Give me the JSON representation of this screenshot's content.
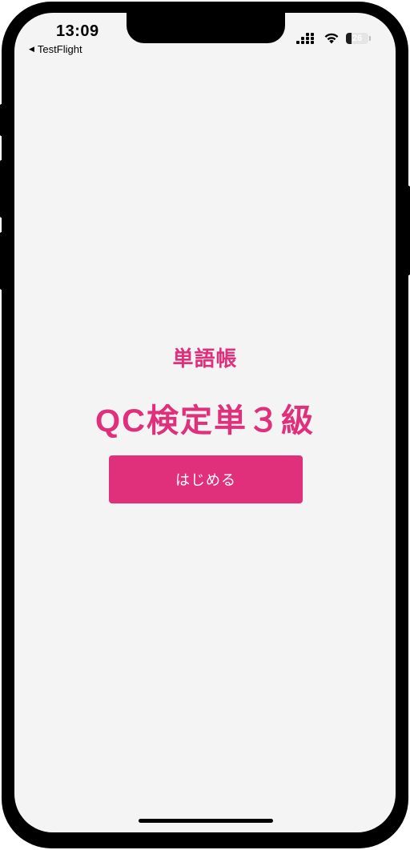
{
  "status_bar": {
    "time": "13:09",
    "back_label": "TestFlight",
    "battery_level": "26",
    "battery_fraction": 0.26
  },
  "main": {
    "subtitle": "単語帳",
    "title": "QC検定単３級",
    "start_button_label": "はじめる"
  },
  "colors": {
    "accent": "#e0307c",
    "background": "#f4f4f5",
    "frame": "#000000"
  },
  "icons": {
    "signal": "cellular-signal-icon",
    "wifi": "wifi-icon",
    "battery": "battery-icon",
    "back": "back-triangle-icon"
  }
}
